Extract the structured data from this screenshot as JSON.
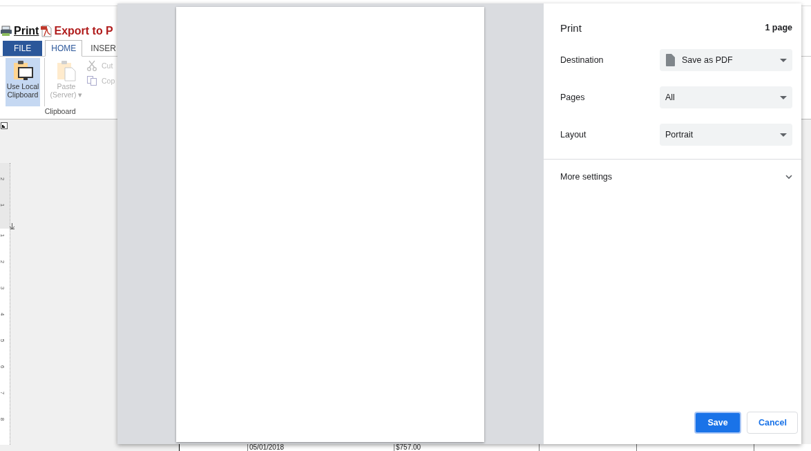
{
  "app": {
    "header_links": [
      {
        "kind": "print",
        "label": "Print"
      },
      {
        "kind": "pdf",
        "label": "Export to P"
      }
    ],
    "tabs": [
      {
        "label": "FILE",
        "kind": "file",
        "selected": false
      },
      {
        "label": "HOME",
        "kind": "tab",
        "selected": true
      },
      {
        "label": "INSER",
        "kind": "tab",
        "selected": false
      }
    ],
    "ribbon": {
      "large_buttons": [
        {
          "kind": "local",
          "lines": [
            "Use Local",
            "Clipboard"
          ],
          "selected": true,
          "disabled": false
        },
        {
          "kind": "paste",
          "lines": [
            "Paste",
            "(Server) ▾"
          ],
          "selected": false,
          "disabled": true
        }
      ],
      "small_buttons": [
        {
          "kind": "cut",
          "label": "Cut",
          "disabled": true
        },
        {
          "kind": "copy",
          "label": "Cop",
          "disabled": true
        }
      ],
      "group_label": "Clipboard"
    },
    "ruler": {
      "labels": [
        "2",
        "1",
        "1",
        "2",
        "3",
        "4",
        "5",
        "6",
        "7",
        "8"
      ]
    },
    "table_row": [
      "05/01/2018",
      "$757.00"
    ]
  },
  "print_dialog": {
    "title": "Print",
    "page_count": "1 page",
    "settings": [
      {
        "label": "Destination",
        "value": "Save as PDF",
        "kind": "destination"
      },
      {
        "label": "Pages",
        "value": "All",
        "kind": "select"
      },
      {
        "label": "Layout",
        "value": "Portrait",
        "kind": "select"
      }
    ],
    "more_settings": {
      "label": "More settings",
      "expanded": false
    },
    "buttons": [
      {
        "label": "Save",
        "kind": "primary"
      },
      {
        "label": "Cancel",
        "kind": "secondary"
      }
    ]
  }
}
